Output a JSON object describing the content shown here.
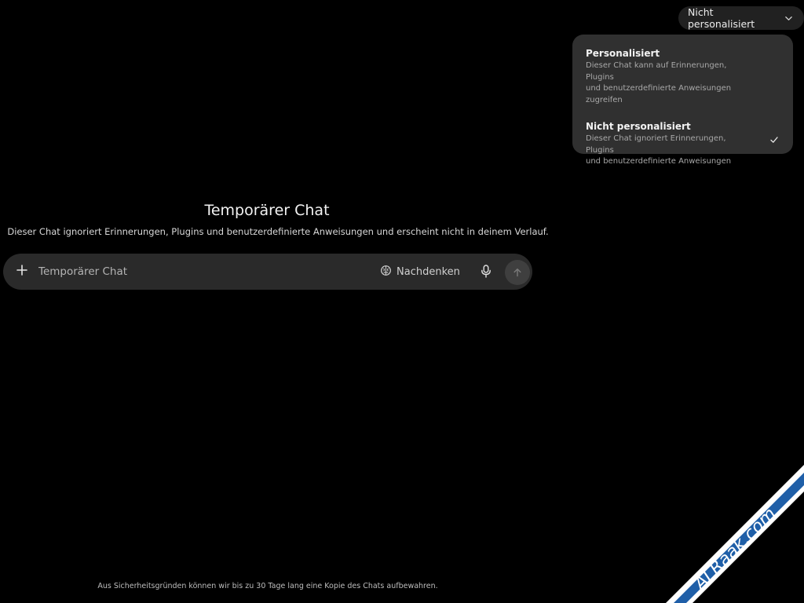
{
  "header": {
    "mode_label": "Nicht personalisiert"
  },
  "dropdown": {
    "options": [
      {
        "title": "Personalisiert",
        "description_lines": [
          "Dieser Chat kann auf Erinnerungen, Plugins",
          "und benutzerdefinierte Anweisungen",
          "zugreifen"
        ],
        "selected": false
      },
      {
        "title": "Nicht personalisiert",
        "description_lines": [
          "Dieser Chat ignoriert Erinnerungen, Plugins",
          "und benutzerdefinierte Anweisungen"
        ],
        "selected": true
      }
    ]
  },
  "main": {
    "title": "Temporärer Chat",
    "subtitle": "Dieser Chat ignoriert Erinnerungen, Plugins und benutzerdefinierte Anweisungen und erscheint nicht in deinem Verlauf."
  },
  "composer": {
    "placeholder": "Temporärer Chat",
    "think_label": "Nachdenken",
    "icons": {
      "add": "plus-icon",
      "think": "brain-icon",
      "mic": "microphone-icon",
      "send": "arrow-up-icon"
    }
  },
  "footer": {
    "notice": "Aus Sicherheitsgründen können wir bis zu 30 Tage lang eine Kopie des Chats aufbewahren."
  },
  "watermark": {
    "text": "ALRaak.com",
    "color": "#1f5fa8"
  },
  "colors": {
    "background": "#000000",
    "surface": "#2a2a2a",
    "menu": "#303030"
  }
}
